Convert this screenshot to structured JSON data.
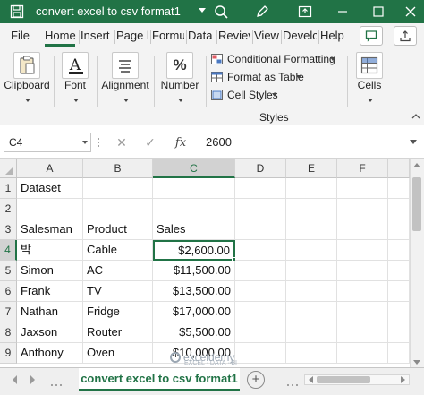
{
  "window": {
    "title": "convert excel to csv format1"
  },
  "tabs": [
    {
      "label": "File"
    },
    {
      "label": "Home"
    },
    {
      "label": "Insert"
    },
    {
      "label": "Page l"
    },
    {
      "label": "Formu"
    },
    {
      "label": "Data"
    },
    {
      "label": "Reviev"
    },
    {
      "label": "View"
    },
    {
      "label": "Develc"
    },
    {
      "label": "Help"
    }
  ],
  "active_tab": "Home",
  "ribbon": {
    "clipboard_label": "Clipboard",
    "font_label": "Font",
    "alignment_label": "Alignment",
    "number_label": "Number",
    "number_icon_glyph": "%",
    "font_icon_glyph": "A",
    "styles": {
      "conditional_formatting": "Conditional Formatting",
      "format_as_table": "Format as Table",
      "cell_styles": "Cell Styles",
      "group_label": "Styles"
    },
    "cells_label": "Cells"
  },
  "formula_bar": {
    "name_box": "C4",
    "cancel_glyph": "✕",
    "enter_glyph": "✓",
    "fx_glyph": "fx",
    "value": "2600"
  },
  "sheet": {
    "columns": [
      "A",
      "B",
      "C",
      "D",
      "E",
      "F"
    ],
    "selected_column": "C",
    "rows": [
      {
        "num": "1",
        "a": "Dataset",
        "b": "",
        "c": ""
      },
      {
        "num": "2",
        "a": "",
        "b": "",
        "c": ""
      },
      {
        "num": "3",
        "a": "Salesman",
        "b": "Product",
        "c": "Sales"
      },
      {
        "num": "4",
        "a": "박",
        "b": "Cable",
        "c": "$2,600.00"
      },
      {
        "num": "5",
        "a": "Simon",
        "b": "AC",
        "c": "$11,500.00"
      },
      {
        "num": "6",
        "a": "Frank",
        "b": "TV",
        "c": "$13,500.00"
      },
      {
        "num": "7",
        "a": "Nathan",
        "b": "Fridge",
        "c": "$17,000.00"
      },
      {
        "num": "8",
        "a": "Jaxson",
        "b": "Router",
        "c": "$5,500.00"
      },
      {
        "num": "9",
        "a": "Anthony",
        "b": "Oven",
        "c": "$10,000.00"
      }
    ],
    "active_cell": "C4",
    "selected_row": "4"
  },
  "sheet_tabs": {
    "active": "convert excel to csv format1",
    "add_glyph": "+"
  },
  "watermark": {
    "brand": "exceldemy",
    "tagline": "EXCEL · DATA · BI"
  },
  "colors": {
    "brand_green": "#217346"
  }
}
